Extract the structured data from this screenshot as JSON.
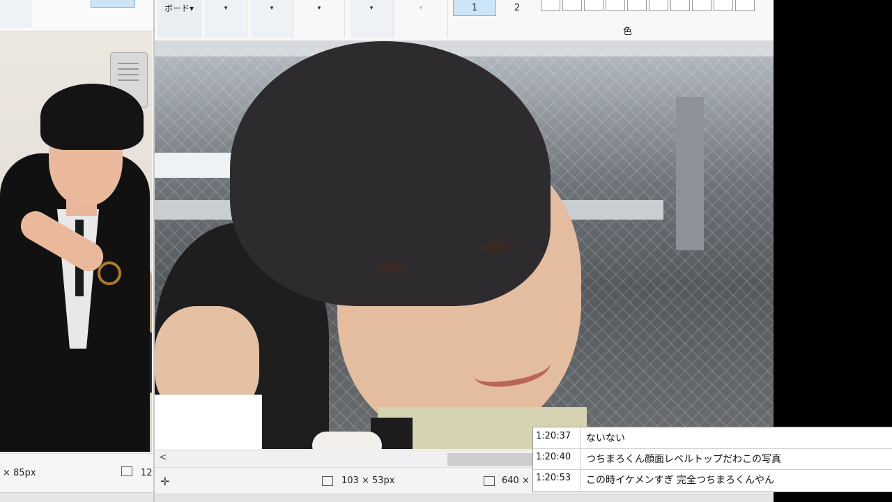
{
  "left_window": {
    "status_size": "× 85px",
    "status_selection": "12"
  },
  "ribbon": {
    "board_label": "ボード",
    "dropdown_arrow": "▾",
    "size_options": [
      "1",
      "2"
    ],
    "color_label": "色",
    "swatch_count": 10
  },
  "statusbar": {
    "move_icon": "✛",
    "selection_size": "103 × 53px",
    "canvas_size": "640 ×"
  },
  "scrollbar": {
    "left_arrow": "<"
  },
  "comments": [
    {
      "time": "1:20:37",
      "text": "ないない"
    },
    {
      "time": "1:20:40",
      "text": "つちまろくん顔面レベルトップだわこの写真"
    },
    {
      "time": "1:20:53",
      "text": "この時イケメンすぎ 完全つちまろくんやん"
    }
  ]
}
